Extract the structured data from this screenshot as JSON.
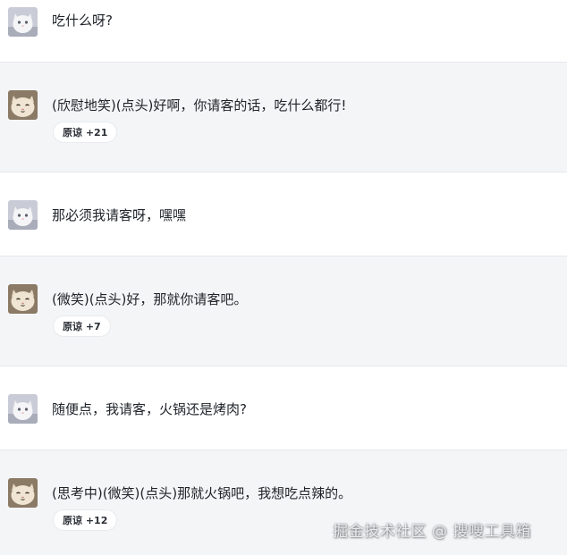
{
  "messages": [
    {
      "role": "user",
      "text": "吃什么呀?"
    },
    {
      "role": "ai",
      "text": "(欣慰地笑)(点头)好啊，你请客的话，吃什么都行!",
      "chip": "原谅 +21"
    },
    {
      "role": "user",
      "text": "那必须我请客呀，嘿嘿"
    },
    {
      "role": "ai",
      "text": "(微笑)(点头)好，那就你请客吧。",
      "chip": "原谅 +7"
    },
    {
      "role": "user",
      "text": "随便点，我请客，火锅还是烤肉?"
    },
    {
      "role": "ai",
      "text": "(思考中)(微笑)(点头)那就火锅吧，我想吃点辣的。",
      "chip": "原谅 +12"
    }
  ],
  "watermark": "掘金技术社区 @ 搜嗖工具箱",
  "colors": {
    "user_bg": "#ffffff",
    "ai_bg": "#f4f5f7",
    "divider": "#e6e8eb",
    "text": "#1f2329"
  },
  "icons": {
    "user_avatar": "white-cat-avatar",
    "ai_avatar": "cream-cat-avatar"
  }
}
